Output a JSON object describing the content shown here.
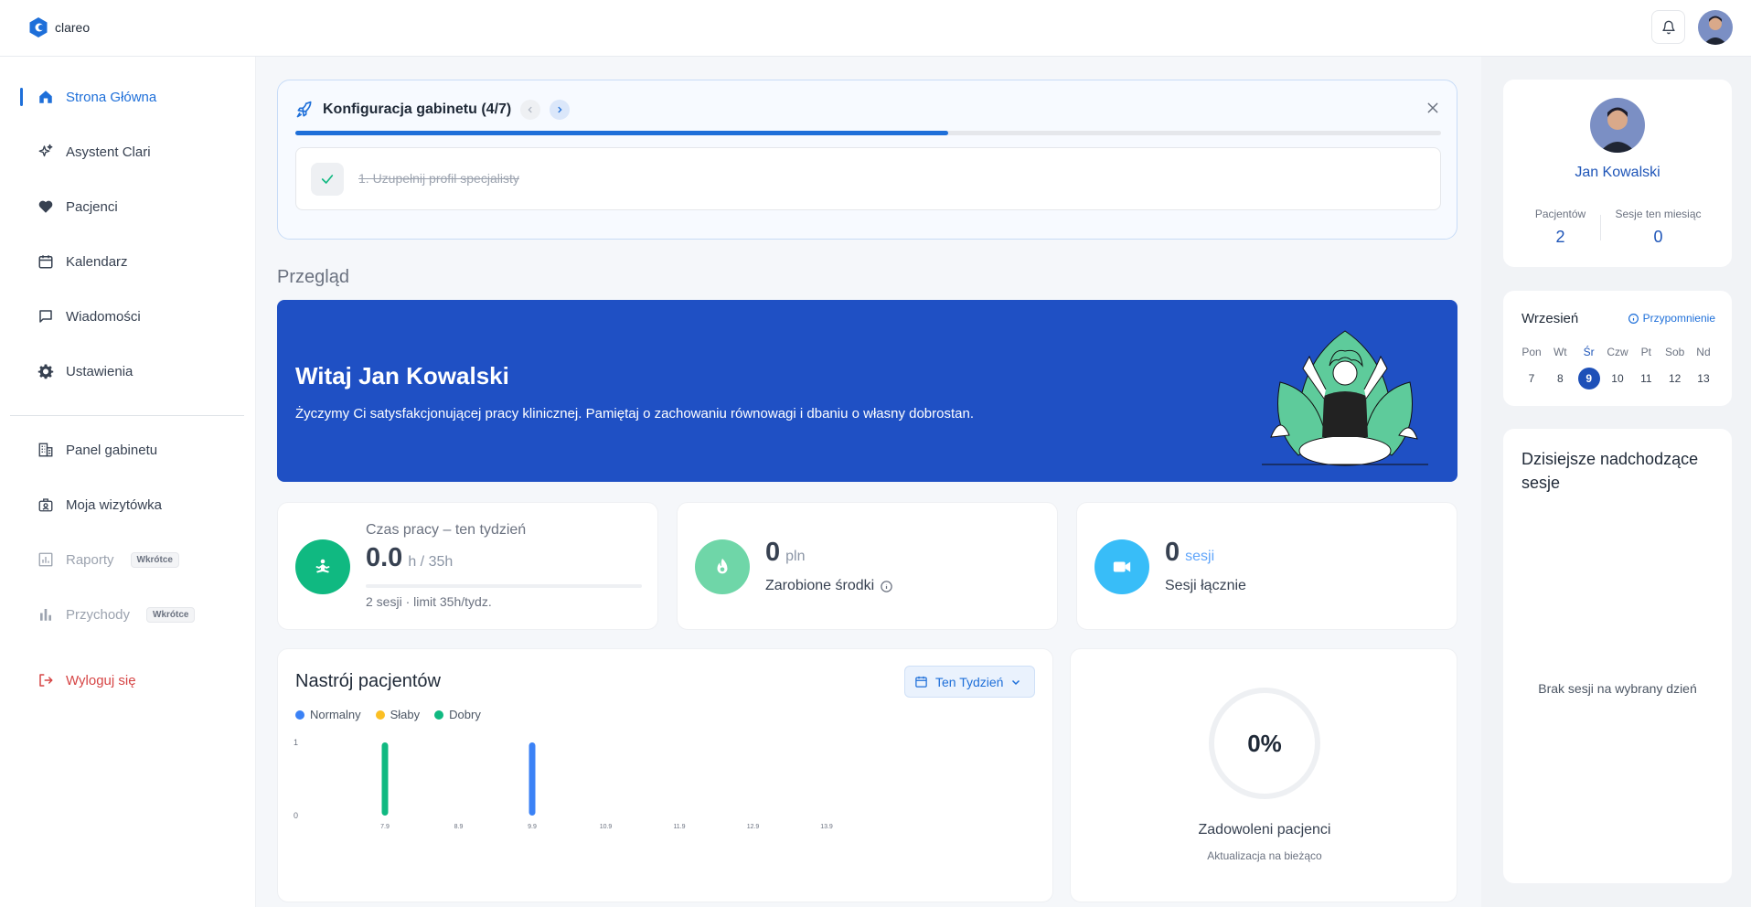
{
  "app": {
    "name": "clareo"
  },
  "sidebar": {
    "items": [
      {
        "label": "Strona Główna"
      },
      {
        "label": "Asystent Clari"
      },
      {
        "label": "Pacjenci"
      },
      {
        "label": "Kalendarz"
      },
      {
        "label": "Wiadomości"
      },
      {
        "label": "Ustawienia"
      },
      {
        "label": "Panel gabinetu"
      },
      {
        "label": "Moja wizytówka"
      },
      {
        "label": "Raporty",
        "badge": "Wkrótce"
      },
      {
        "label": "Przychody",
        "badge": "Wkrótce"
      }
    ],
    "logout": "Wyloguj się"
  },
  "setup": {
    "title": "Konfiguracja gabinetu (4/7)",
    "progress": 0.57,
    "step": "1. Uzupełnij profil specjalisty"
  },
  "overview": {
    "title": "Przegląd",
    "hero_title": "Witaj Jan Kowalski",
    "hero_sub": "Życzymy Ci satysfakcjonującej pracy klinicznej. Pamiętaj o zachowaniu równowagi i dbaniu o własny dobrostan."
  },
  "stats": {
    "work": {
      "label": "Czas pracy – ten tydzień",
      "value": "0.0",
      "unit": "h / 35h",
      "note": "2 sesji · limit 35h/tydz.",
      "progress": 0
    },
    "earnings": {
      "value": "0",
      "unit": "pln",
      "label": "Zarobione środki"
    },
    "sessions": {
      "value": "0",
      "unit": "sesji",
      "label": "Sesji łącznie"
    }
  },
  "mood": {
    "title": "Nastrój pacjentów",
    "range": "Ten Tydzień"
  },
  "satisfaction": {
    "value": "0%",
    "label": "Zadowoleni pacjenci",
    "note": "Aktualizacja na bieżąco"
  },
  "profile": {
    "name": "Jan Kowalski",
    "patients_label": "Pacjentów",
    "patients_value": "2",
    "sessions_label": "Sesje ten miesiąc",
    "sessions_value": "0"
  },
  "calendar": {
    "month": "Wrzesień",
    "reminder": "Przypomnienie",
    "days": [
      {
        "name": "Pon",
        "date": "7"
      },
      {
        "name": "Wt",
        "date": "8"
      },
      {
        "name": "Śr",
        "date": "9",
        "today": true
      },
      {
        "name": "Czw",
        "date": "10"
      },
      {
        "name": "Pt",
        "date": "11"
      },
      {
        "name": "Sob",
        "date": "12"
      },
      {
        "name": "Nd",
        "date": "13"
      }
    ]
  },
  "upcoming": {
    "title": "Dzisiejsze nadchodzące sesje",
    "empty": "Brak sesji na wybrany dzień"
  },
  "colors": {
    "primary": "#1e6fd9",
    "hero": "#1f50c4",
    "normal": "#3b82f6",
    "weak": "#fbbf24",
    "good": "#10b981"
  },
  "chart_data": {
    "type": "bar",
    "x": [
      "7.9",
      "8.9",
      "9.9",
      "10.9",
      "11.9",
      "12.9",
      "13.9"
    ],
    "series": [
      {
        "name": "Normalny",
        "color": "#3b82f6",
        "values": [
          0,
          0,
          1,
          0,
          0,
          0,
          0
        ]
      },
      {
        "name": "Słaby",
        "color": "#fbbf24",
        "values": [
          0,
          0,
          0,
          0,
          0,
          0,
          0
        ]
      },
      {
        "name": "Dobry",
        "color": "#10b981",
        "values": [
          1,
          0,
          0,
          0,
          0,
          0,
          0
        ]
      }
    ],
    "y_ticks": [
      "1",
      "0"
    ],
    "ylim": [
      0,
      1
    ]
  }
}
